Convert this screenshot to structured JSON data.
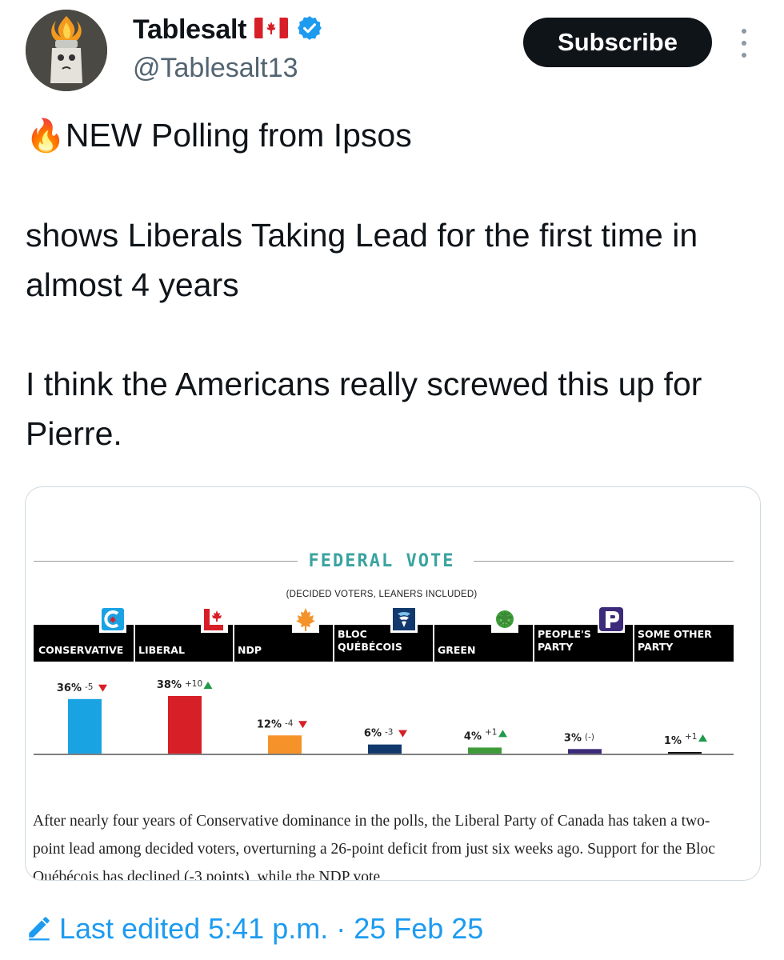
{
  "author": {
    "display_name": "Tablesalt",
    "flag_emoji": "🇨🇦",
    "verified_icon": "verified-badge-icon",
    "handle": "@Tablesalt13",
    "avatar_icon": "salt-shaker-avatar"
  },
  "actions": {
    "subscribe_label": "Subscribe",
    "more_icon": "vertical-ellipsis-icon"
  },
  "tweet": {
    "line1_emoji": "🔥",
    "line1_text": "NEW Polling from Ipsos",
    "para2": "shows Liberals Taking Lead for the first time in almost 4 years",
    "para3": "I think the Americans really screwed this up for Pierre."
  },
  "media": {
    "title": "FEDERAL VOTE",
    "subtitle": "(DECIDED VOTERS, LEANERS INCLUDED)",
    "caption": "After nearly four years of Conservative dominance in the polls, the Liberal Party of Canada has taken a two-point lead among decided voters, overturning a 26-point deficit from just six weeks ago. Support for the Bloc Québécois has declined (-3 points), while the NDP vote"
  },
  "chart_data": {
    "type": "bar",
    "title": "FEDERAL VOTE",
    "subtitle": "(DECIDED VOTERS, LEANERS INCLUDED)",
    "categories": [
      "CONSERVATIVE",
      "LIBERAL",
      "NDP",
      "BLOC QUÉBÉCOIS",
      "GREEN",
      "PEOPLE'S PARTY",
      "SOME OTHER PARTY"
    ],
    "values": [
      36,
      38,
      12,
      6,
      4,
      3,
      1
    ],
    "value_labels": [
      "36%",
      "38%",
      "12%",
      "6%",
      "4%",
      "3%",
      "1%"
    ],
    "changes": [
      "-5",
      "+10",
      "-4",
      "-3",
      "+1",
      "(-)",
      "+1"
    ],
    "change_direction": [
      "down",
      "up",
      "down",
      "down",
      "up",
      "none",
      "up"
    ],
    "colors": [
      "#1aa3e3",
      "#d71f27",
      "#f5922a",
      "#12396e",
      "#3f9b3a",
      "#3c2a7a",
      "#111111"
    ],
    "up_color": "#1f9a4a",
    "down_color": "#d71f27",
    "ylim": [
      0,
      40
    ],
    "xlabel": "",
    "ylabel": ""
  },
  "footer": {
    "edit_icon": "pencil-icon",
    "edited_text": "Last edited 5:41 p.m. · 25 Feb 25"
  }
}
